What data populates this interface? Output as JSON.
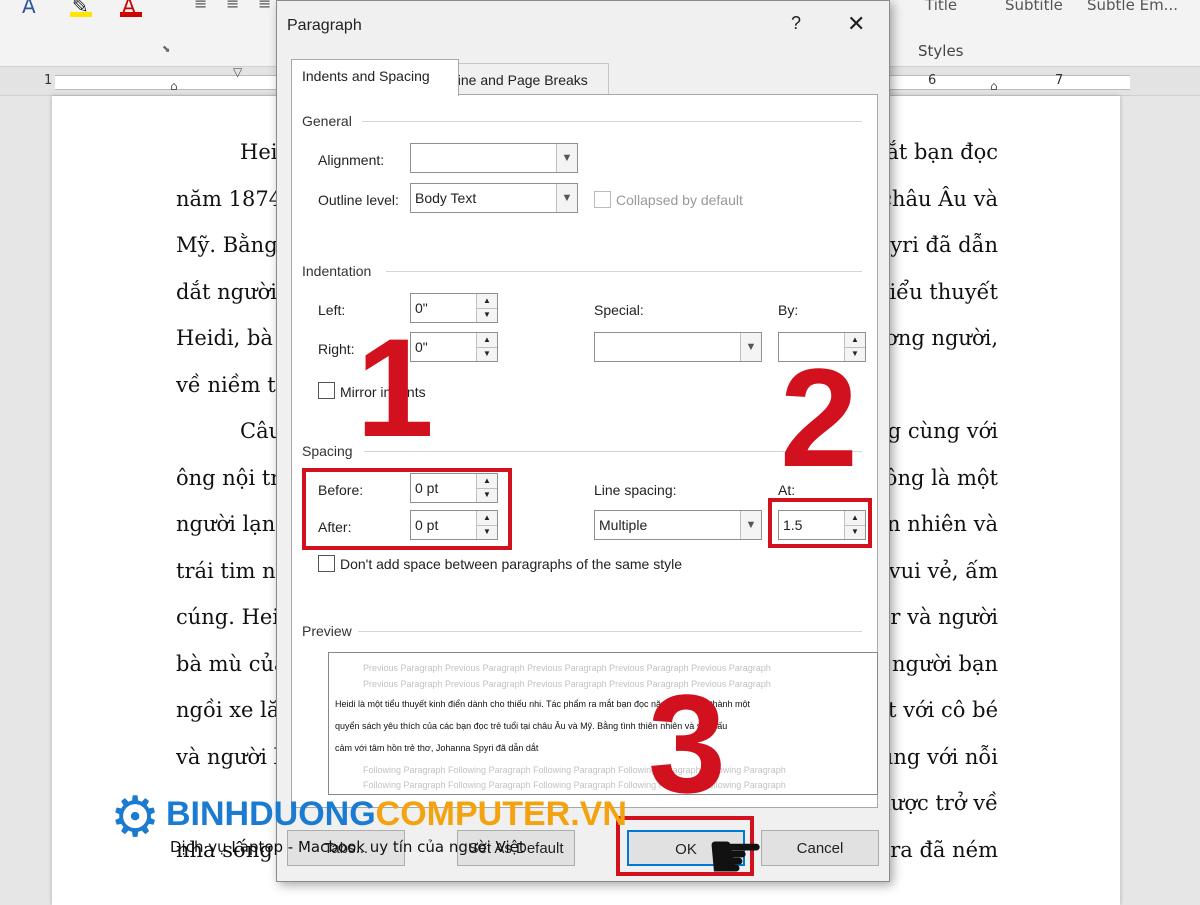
{
  "ribbon": {
    "styles_group_label": "Styles",
    "style_names": [
      "Title",
      "Subtitle",
      "Subtle Em..."
    ]
  },
  "ruler": {
    "numbers_left": [
      "1"
    ],
    "numbers_right": [
      "6",
      "7"
    ]
  },
  "document": {
    "left_lines": [
      "Heid",
      "năm 1874,",
      "Mỹ. Bằng",
      "dắt người",
      "Heidi, bà đ",
      "về niềm tin",
      "Câu",
      "ông nội trê",
      "người lạnh",
      "trái tim nh",
      "cúng. Heid",
      "bà mù của",
      "ngồi xe lă",
      "và người b",
      "",
      "nha sống"
    ],
    "right_lines": [
      "mắt bạn đọc",
      "châu Âu và",
      "Spyri đã dẫn",
      "u tiểu thuyết",
      "ương người,",
      "",
      "ng cùng với",
      "ông là một",
      "ồn nhiên và",
      "vui vẻ, ấm",
      "ter và người",
      "t người bạn",
      "ết với cô bé",
      "ùng với nỗi",
      "được trở về",
      "lara đã ném"
    ]
  },
  "dialog": {
    "title": "Paragraph",
    "help_label": "?",
    "close_label": "✕",
    "tabs": [
      {
        "label": "Indents and Spacing",
        "active": true
      },
      {
        "label": "Line and Page Breaks",
        "active": false
      }
    ],
    "general": {
      "section_label": "General",
      "alignment_label": "Alignment:",
      "alignment_value": "",
      "outline_label": "Outline level:",
      "outline_value": "Body Text",
      "collapsed_label": "Collapsed by default"
    },
    "indentation": {
      "section_label": "Indentation",
      "left_label": "Left:",
      "left_value": "0\"",
      "right_label": "Right:",
      "right_value": "0\"",
      "special_label": "Special:",
      "special_value": "",
      "by_label": "By:",
      "by_value": "",
      "mirror_label": "Mirror indents"
    },
    "spacing": {
      "section_label": "Spacing",
      "before_label": "Before:",
      "before_value": "0 pt",
      "after_label": "After:",
      "after_value": "0 pt",
      "line_spacing_label": "Line spacing:",
      "line_spacing_value": "Multiple",
      "at_label": "At:",
      "at_value": "1.5",
      "dont_add_label": "Don't add space between paragraphs of the same style"
    },
    "preview": {
      "section_label": "Preview",
      "previous_text": "Previous Paragraph Previous Paragraph Previous Paragraph Previous Paragraph Previous Paragraph",
      "sample_lines": [
        "Heidi là một tiểu thuyết kinh điển dành cho thiếu nhi. Tác phẩm ra mắt bạn đọc năm 1874, trở thành một",
        "quyển sách yêu thích của các bạn đọc trẻ tuổi tại châu Âu và Mỹ. Bằng tình thiên nhiên và sự thấu",
        "cảm với tâm hồn trẻ thơ, Johanna Spyri đã dẫn dắt"
      ],
      "following_text": "Following Paragraph Following Paragraph Following Paragraph Following Paragraph Following Paragraph"
    },
    "buttons": {
      "tabs_label": "Tabs...",
      "default_label": "Set As Default",
      "ok_label": "OK",
      "cancel_label": "Cancel"
    }
  },
  "annotations": {
    "step1": "1",
    "step2": "2",
    "step3": "3",
    "highlight_color": "#d2111e"
  },
  "watermark": {
    "logo_blue": "BINHDUONG",
    "logo_orange": "COMPUTER.VN",
    "tagline": "Dịch vụ Laptop - Macbook uy tín của người Việt"
  }
}
